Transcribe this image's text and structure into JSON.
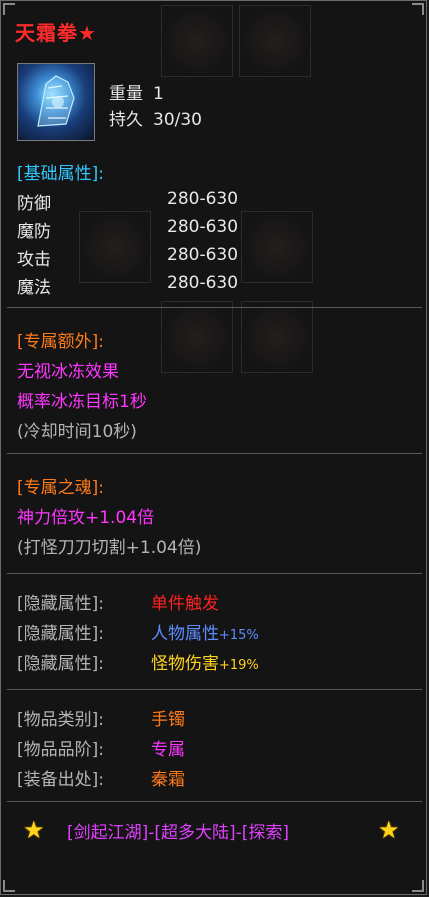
{
  "item": {
    "name": "天霜拳",
    "name_star": "★",
    "weight_label": "重量",
    "weight_value": "1",
    "durability_label": "持久",
    "durability_value": "30/30"
  },
  "base_attrs": {
    "header": "[基础属性]:",
    "rows": [
      {
        "label": "防御",
        "value": "280-630"
      },
      {
        "label": "魔防",
        "value": "280-630"
      },
      {
        "label": "攻击",
        "value": "280-630"
      },
      {
        "label": "魔法",
        "value": "280-630"
      }
    ]
  },
  "exclusive_extra": {
    "header": "[专属额外]:",
    "line1": "无视冰冻效果",
    "line2": "概率冰冻目标1秒",
    "line3": "(冷却时间10秒)"
  },
  "exclusive_soul": {
    "header": "[专属之魂]:",
    "line1_main": "神力倍攻",
    "line1_val": "+1.04倍",
    "line2": "(打怪刀刀切割+1.04倍)"
  },
  "hidden_attrs": [
    {
      "label": "[隐藏属性]:",
      "value": "单件触发",
      "bonus": ""
    },
    {
      "label": "[隐藏属性]:",
      "value": "人物属性",
      "bonus": "+15%"
    },
    {
      "label": "[隐藏属性]:",
      "value": "怪物伤害",
      "bonus": "+19%"
    }
  ],
  "item_info": [
    {
      "label": "[物品类别]:",
      "value": "手镯"
    },
    {
      "label": "[物品品阶]:",
      "value": "专属"
    },
    {
      "label": "[装备出处]:",
      "value": "秦霜"
    }
  ],
  "footer": {
    "left_star": "★",
    "text": "[剑起江湖]-[超多大陆]-[探索]",
    "right_star": "★"
  },
  "colors": {
    "title": "#ff2b2b",
    "header_cyan": "#31c7ff",
    "header_orange": "#ff7a1a",
    "magenta": "#ff36ff",
    "star": "#ffd31a"
  }
}
